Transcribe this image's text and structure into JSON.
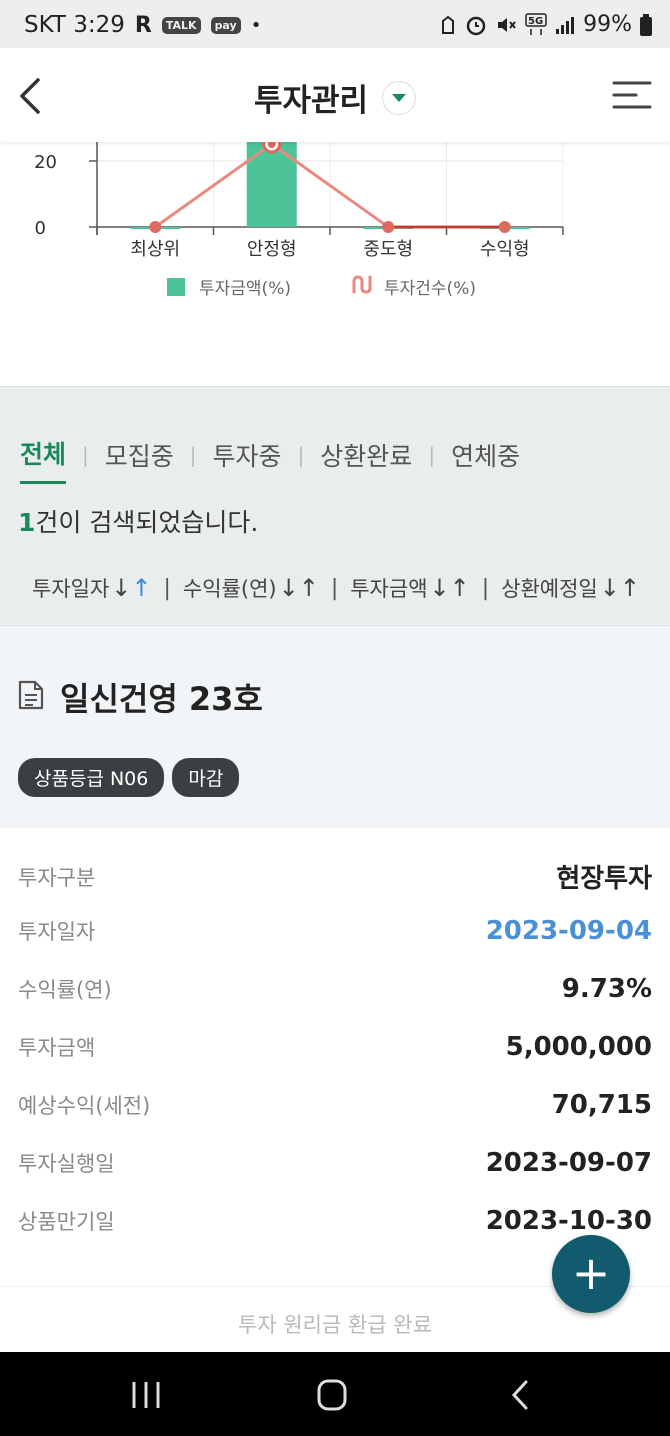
{
  "status_bar": {
    "carrier_time": "SKT 3:29",
    "app_icons": [
      "R",
      "TALK",
      "pay",
      "•"
    ],
    "right_icons": [
      "recycle-icon",
      "alarm-icon",
      "mute-icon",
      "5g-icon",
      "signal-icon"
    ],
    "battery": "99%"
  },
  "header": {
    "title": "투자관리",
    "back_icon": "back-arrow-icon",
    "dropdown_icon": "dropdown-triangle-icon",
    "menu_icon": "menu-icon"
  },
  "chart_data": {
    "type": "bar",
    "categories": [
      "최상위",
      "안정형",
      "중도형",
      "수익형"
    ],
    "y_ticks": [
      "20",
      "0"
    ],
    "series": [
      {
        "name": "투자금액(%)",
        "type": "bar",
        "color": "#4dc497",
        "values": [
          0,
          100,
          0,
          0
        ]
      },
      {
        "name": "투자건수(%)",
        "type": "line",
        "color": "#e98a80",
        "values": [
          0,
          100,
          0,
          0
        ]
      }
    ],
    "legend": [
      "투자금액(%)",
      "투자건수(%)"
    ],
    "legend_position": "bottom"
  },
  "filter": {
    "tabs": [
      "전체",
      "모집중",
      "투자중",
      "상환완료",
      "연체중"
    ],
    "active_tab": "전체",
    "count_num": "1",
    "count_text": "건이 검색되었습니다.",
    "sorts": [
      "투자일자",
      "수익률(연)",
      "투자금액",
      "상환예정일"
    ],
    "sort_down": "↓",
    "sort_up": "↑",
    "sep": "|"
  },
  "product": {
    "name": "일신건영 23호",
    "icon": "document-icon",
    "badges": [
      "상품등급 N06",
      "마감"
    ]
  },
  "details": [
    {
      "label": "투자구분",
      "value": "현장투자"
    },
    {
      "label": "투자일자",
      "value": "2023-09-04"
    },
    {
      "label": "수익률(연)",
      "value": "9.73%"
    },
    {
      "label": "투자금액",
      "value": "5,000,000"
    },
    {
      "label": "예상수익(세전)",
      "value": "70,715"
    },
    {
      "label": "투자실행일",
      "value": "2023-09-07"
    },
    {
      "label": "상품만기일",
      "value": "2023-10-30"
    }
  ],
  "footer_note": "투자 원리금 환급 완료",
  "fab_label": "+",
  "nav": {
    "recent": "recent-apps-icon",
    "home": "home-icon",
    "back": "nav-back-icon"
  }
}
